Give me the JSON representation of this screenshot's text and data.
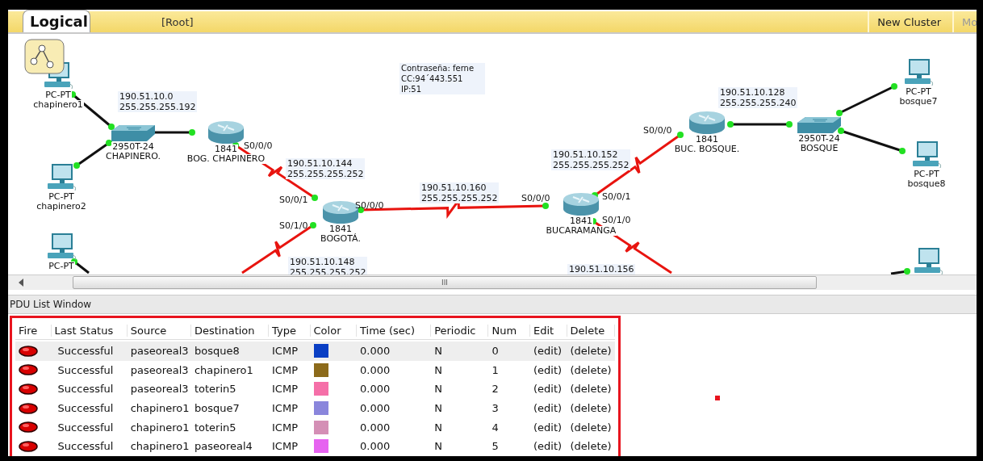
{
  "toolbar": {
    "view_tab": "Logical",
    "path": "[Root]",
    "buttons": [
      "New Cluster",
      "Mo"
    ]
  },
  "devices": [
    {
      "kind": "pc",
      "model": "PC-PT",
      "name": "chapinero1"
    },
    {
      "kind": "pc",
      "model": "PC-PT",
      "name": "chapinero2"
    },
    {
      "kind": "pc",
      "model": "PC-PT"
    },
    {
      "kind": "switch",
      "model": "2950T-24",
      "name": "CHAPINERO."
    },
    {
      "kind": "router",
      "model": "1841",
      "name": "BOG. CHAPINERO"
    },
    {
      "kind": "router",
      "model": "1841",
      "name": "BOGOTÁ."
    },
    {
      "kind": "router",
      "model": "1841",
      "name": "BUCARAMANGA"
    },
    {
      "kind": "router",
      "model": "1841",
      "name": "BUC. BOSQUE."
    },
    {
      "kind": "switch",
      "model": "2950T-24",
      "name": "BOSQUE"
    },
    {
      "kind": "pc",
      "model": "PC-PT",
      "name": "bosque7"
    },
    {
      "kind": "pc",
      "model": "PC-PT",
      "name": "bosque8"
    },
    {
      "kind": "pc"
    }
  ],
  "links": [
    {
      "kind": "ethernet"
    },
    {
      "kind": "ethernet"
    },
    {
      "kind": "ethernet"
    },
    {
      "kind": "ethernet"
    },
    {
      "kind": "serial"
    },
    {
      "kind": "serial"
    },
    {
      "kind": "serial"
    },
    {
      "kind": "serial"
    },
    {
      "kind": "serial"
    },
    {
      "kind": "ethernet"
    },
    {
      "kind": "ethernet"
    },
    {
      "kind": "ethernet"
    },
    {
      "kind": "ethernet"
    }
  ],
  "port_labels": [
    "S0/0/0",
    "S0/0/1",
    "S0/1/0",
    "S0/0/0",
    "S0/0/0",
    "S0/0/1",
    "S0/1/0",
    "S0/0/0"
  ],
  "network_labels": [
    {
      "lines": [
        "190.51.10.0",
        "255.255.255.192"
      ]
    },
    {
      "lines": [
        "190.51.10.144",
        "255.255.255.252"
      ]
    },
    {
      "lines": [
        "190.51.10.160",
        "255.255.255.252"
      ]
    },
    {
      "lines": [
        "190.51.10.148",
        "255.255.255.252"
      ]
    },
    {
      "lines": [
        "190.51.10.152",
        "255.255.255.252"
      ]
    },
    {
      "lines": [
        "190.51.10.128",
        "255.255.255.240"
      ]
    },
    {
      "lines": [
        "190.51.10.156"
      ]
    }
  ],
  "note": {
    "lines": [
      "Contraseña: ferne",
      "CC:94´443.551",
      "IP:51"
    ]
  },
  "scrollbar": {
    "grip": "III"
  },
  "pdu_window": {
    "title": "PDU List Window",
    "columns": [
      "Fire",
      "Last Status",
      "Source",
      "Destination",
      "Type",
      "Color",
      "Time (sec)",
      "Periodic",
      "Num",
      "Edit",
      "Delete"
    ],
    "rows": [
      {
        "selected": true,
        "status": "Successful",
        "source": "paseoreal3",
        "destination": "bosque8",
        "type": "ICMP",
        "color": "#0a3fc4",
        "time": "0.000",
        "periodic": "N",
        "num": "0",
        "edit": "(edit)",
        "delete": "(delete)"
      },
      {
        "selected": false,
        "status": "Successful",
        "source": "paseoreal3",
        "destination": "chapinero1",
        "type": "ICMP",
        "color": "#8c6a1a",
        "time": "0.000",
        "periodic": "N",
        "num": "1",
        "edit": "(edit)",
        "delete": "(delete)"
      },
      {
        "selected": false,
        "status": "Successful",
        "source": "paseoreal3",
        "destination": "toterin5",
        "type": "ICMP",
        "color": "#f56fa8",
        "time": "0.000",
        "periodic": "N",
        "num": "2",
        "edit": "(edit)",
        "delete": "(delete)"
      },
      {
        "selected": false,
        "status": "Successful",
        "source": "chapinero1",
        "destination": "bosque7",
        "type": "ICMP",
        "color": "#8a86dc",
        "time": "0.000",
        "periodic": "N",
        "num": "3",
        "edit": "(edit)",
        "delete": "(delete)"
      },
      {
        "selected": false,
        "status": "Successful",
        "source": "chapinero1",
        "destination": "toterin5",
        "type": "ICMP",
        "color": "#d48fb5",
        "time": "0.000",
        "periodic": "N",
        "num": "4",
        "edit": "(edit)",
        "delete": "(delete)"
      },
      {
        "selected": false,
        "status": "Successful",
        "source": "chapinero1",
        "destination": "paseoreal4",
        "type": "ICMP",
        "color": "#e663f0",
        "time": "0.000",
        "periodic": "N",
        "num": "5",
        "edit": "(edit)",
        "delete": "(delete)"
      }
    ]
  }
}
